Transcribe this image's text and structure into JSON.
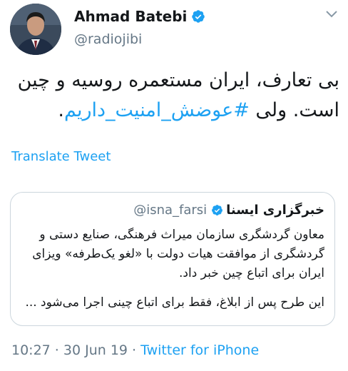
{
  "author": {
    "display_name": "Ahmad Batebi",
    "handle": "@radiojibi",
    "verified": true
  },
  "tweet": {
    "text_before": "بی تعارف، ایران مستعمره روسیه و چین است. ولی ",
    "hashtag": "#عوضش_امنیت_داریم",
    "text_after": "."
  },
  "translate_label": "Translate Tweet",
  "quoted_tweet": {
    "display_name": "خبرگزاری ایسنا",
    "handle": "@isna_farsi",
    "verified": true,
    "paragraph_1": "معاون گردشگری سازمان میراث فرهنگی، صنایع دستی و گردشگری از موافقت هیات دولت با «لغو یک‌طرفه» ویزای ایران برای اتباع چین خبر داد.",
    "paragraph_2": "این طرح پس از ابلاغ، فقط برای اتباع چینی اجرا می‌شود ..."
  },
  "meta": {
    "time": "10:27",
    "separator": " · ",
    "date": "30 Jun 19",
    "source": "Twitter for iPhone"
  },
  "colors": {
    "accent": "#1da1f2",
    "secondary_text": "#657786",
    "border": "#ccd6dd"
  },
  "icons": [
    "avatar-photo",
    "verified-badge-icon",
    "chevron-down-icon"
  ]
}
